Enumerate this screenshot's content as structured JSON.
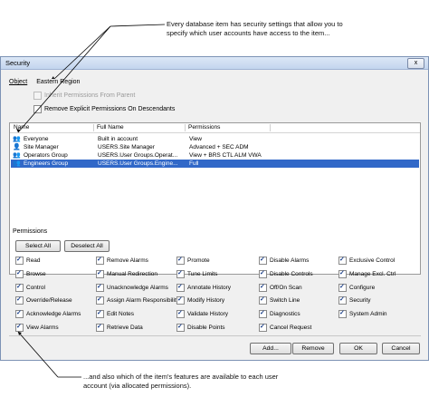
{
  "callouts": {
    "top": "Every database item has security settings that allow you to specify which user accounts have access to the item...",
    "bottom": "...and also which of the item's features are available to each user account (via allocated permissions)."
  },
  "dialog": {
    "title": "Security",
    "close_label": "x",
    "object_label": "Object",
    "object_value": "Eastern Region",
    "inherit_label": "Inherit Permissions From Parent",
    "remove_label": "Remove Explicit Permissions On Descendants"
  },
  "grid": {
    "columns": [
      "Name",
      "Full Name",
      "Permissions"
    ],
    "rows": [
      {
        "name": "Everyone",
        "full_name": "Built in account",
        "permissions": "View",
        "icon": "group-icon"
      },
      {
        "name": "Site Manager",
        "full_name": "USERS.Site Manager",
        "permissions": "Advanced + SEC ADM",
        "icon": "user-icon"
      },
      {
        "name": "Operators Group",
        "full_name": "USERS.User Groups.Operat...",
        "permissions": "View + BRS CTL ALM VWA",
        "icon": "group-icon"
      },
      {
        "name": "Engineers Group",
        "full_name": "USERS.User Groups.Engine...",
        "permissions": "Full",
        "icon": "group-icon",
        "selected": true
      }
    ]
  },
  "permissions": {
    "label": "Permissions",
    "select_all": "Select All",
    "deselect_all": "Deselect All",
    "columns": [
      [
        "Read",
        "Browse",
        "Control",
        "Override/Release",
        "Acknowledge Alarms",
        "View Alarms"
      ],
      [
        "Remove Alarms",
        "Manual Redirection",
        "Unacknowledge Alarms",
        "Assign Alarm Responsibility",
        "Edit Notes",
        "Retrieve Data"
      ],
      [
        "Promote",
        "Tune Limits",
        "Annotate History",
        "Modify History",
        "Validate History",
        "Disable Points"
      ],
      [
        "Disable Alarms",
        "Disable Controls",
        "Off/On Scan",
        "Switch Line",
        "Diagnostics",
        "Cancel Request"
      ],
      [
        "Exclusive Control",
        "Manage Excl. Ctrl",
        "Configure",
        "Security",
        "System Admin"
      ]
    ]
  },
  "footer": {
    "add": "Add...",
    "remove": "Remove",
    "ok": "OK",
    "cancel": "Cancel"
  }
}
